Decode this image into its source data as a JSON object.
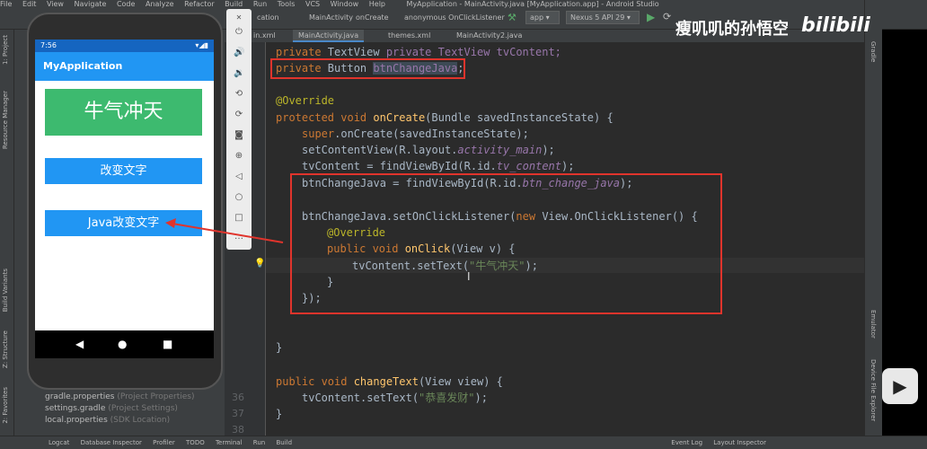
{
  "menu": [
    "File",
    "Edit",
    "View",
    "Navigate",
    "Code",
    "Analyze",
    "Refactor",
    "Build",
    "Run",
    "Tools",
    "VCS",
    "Window",
    "Help"
  ],
  "window_title": "MyApplication - MainActivity.java [MyApplication.app] - Android Studio",
  "breadcrumb": [
    "cation",
    "MainActivity",
    "onCreate",
    "anonymous OnClickListener"
  ],
  "run_config": "app",
  "device": "Nexus 5 API 29",
  "tabs": [
    "in.xml",
    "MainActivity.java",
    "themes.xml",
    "MainActivity2.java"
  ],
  "left_strip": [
    "1: Project",
    "Resource Manager",
    "Build Variants",
    "Z: Structure",
    "2: Favorites"
  ],
  "right_strip": [
    "Gradle",
    "Emulator",
    "Device File Explorer"
  ],
  "project_files": [
    {
      "name": "gradle.properties",
      "meta": "(Project Properties)"
    },
    {
      "name": "settings.gradle",
      "meta": "(Project Settings)"
    },
    {
      "name": "local.properties",
      "meta": "(SDK Location)"
    }
  ],
  "bottom": [
    "Logcat",
    "Database Inspector",
    "Profiler",
    "TODO",
    "Terminal",
    "Run",
    "Build",
    "Event Log",
    "Layout Inspector"
  ],
  "line_numbers": {
    "l36": "36",
    "l37": "37",
    "l38": "38"
  },
  "code": {
    "l1": "private TextView tvContent;",
    "l2_kw": "private ",
    "l2_type": "Button ",
    "l2_var": "btnChangeJava",
    "l3": "@Override",
    "l4_kw": "protected void ",
    "l4_fn": "onCreate",
    "l4_rest": "(Bundle savedInstanceState) {",
    "l5_kw": "super",
    ".": ".",
    "l5_rest": ".onCreate(savedInstanceState);",
    "l6_a": "setContentView(R.layout.",
    "l6_b": "activity_main",
    "l6_c": ");",
    "l7_a": "tvContent = findViewById(R.id.",
    "l7_b": "tv_content",
    "l7_c": ");",
    "l8_a": "btnChangeJava = findViewById(R.id.",
    "l8_b": "btn_change_java",
    "l8_c": ");",
    "l9_a": "btnChangeJava.setOnClickListener(",
    "l9_kw": "new ",
    "l9_b": "View.OnClickListener() {",
    "l10": "@Override",
    "l11_kw": "public void ",
    "l11_fn": "onClick",
    "l11_b": "(View v) {",
    "l12_a": "tvContent.setText(",
    "l12_s": "\"牛气冲天\"",
    "l12_c": ");",
    "l13": "}",
    "l14": "});",
    "l15": "}",
    "l16_kw": "public void ",
    "l16_fn": "changeText",
    "l16_b": "(View view) {",
    "l17_a": "tvContent.setText(",
    "l17_s": "\"恭喜发财\"",
    "l17_c": ");",
    "l18": "}"
  },
  "phone": {
    "time": "7:56",
    "app_title": "MyApplication",
    "tv_content": "牛气冲天",
    "btn1": "改变文字",
    "btn2": "Java改变文字"
  },
  "watermark": "瘦叽叽的孙悟空",
  "watermark_logo": "bilibili",
  "colors": {
    "keyword": "#cc7832",
    "function": "#ffc66d",
    "annotation": "#bbb529",
    "field": "#9876aa",
    "string": "#6a8759",
    "highlight": "#e0342c",
    "app_bar": "#2196f3",
    "text_view_bg": "#3dba6f"
  }
}
